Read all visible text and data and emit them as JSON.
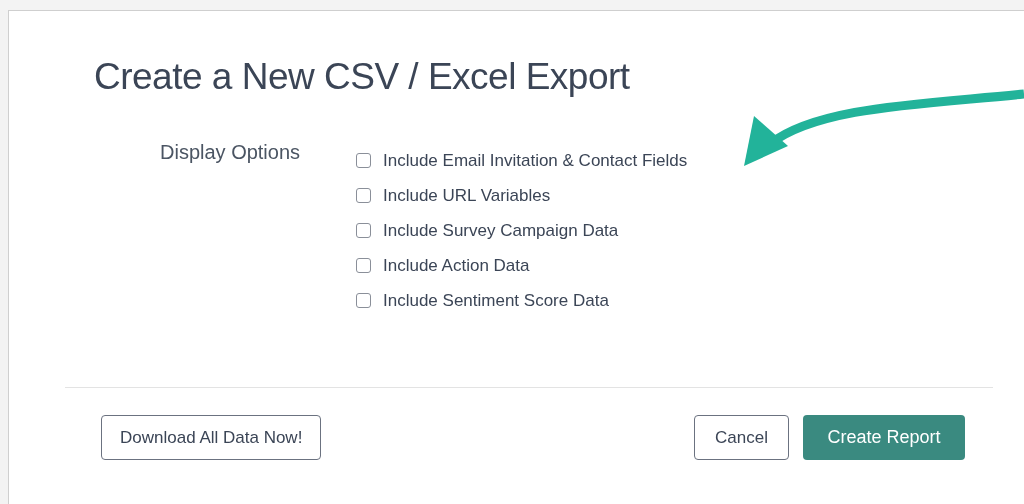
{
  "dialog": {
    "title": "Create a New CSV / Excel Export",
    "display_options": {
      "label": "Display Options",
      "options": [
        {
          "label": "Include Email Invitation & Contact Fields",
          "checked": false
        },
        {
          "label": "Include URL Variables",
          "checked": false
        },
        {
          "label": "Include Survey Campaign Data",
          "checked": false
        },
        {
          "label": "Include Action Data",
          "checked": false
        },
        {
          "label": "Include Sentiment Score Data",
          "checked": false
        }
      ]
    },
    "buttons": {
      "download": "Download All Data Now!",
      "cancel": "Cancel",
      "create": "Create Report"
    }
  }
}
